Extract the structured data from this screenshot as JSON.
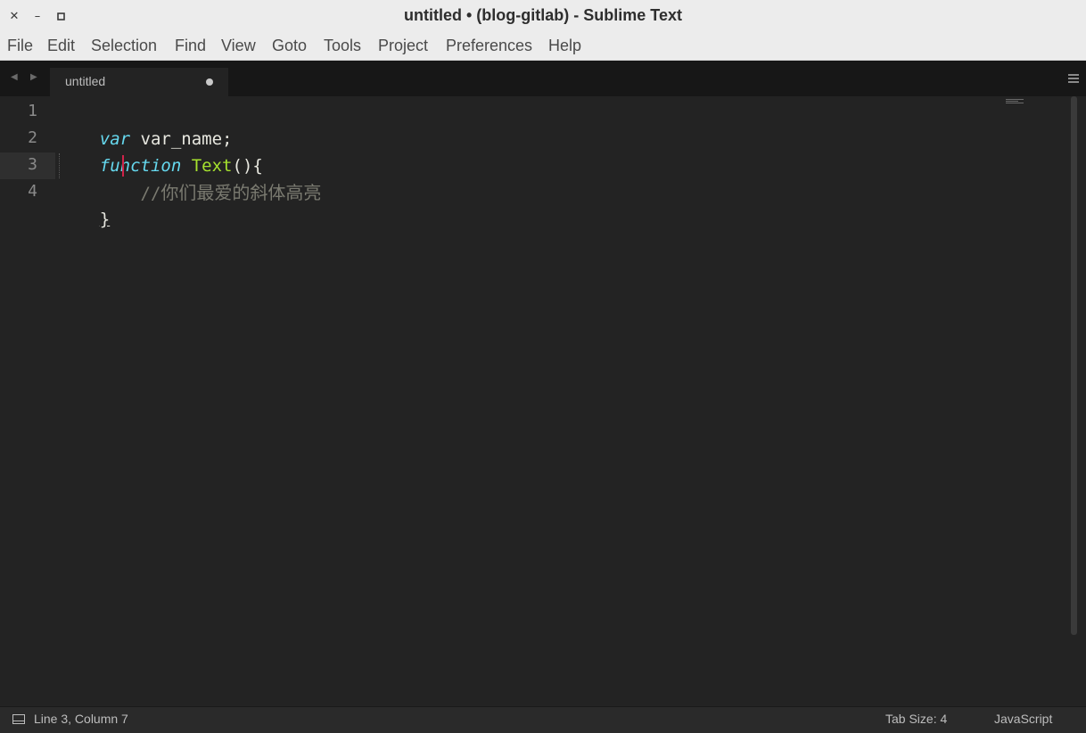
{
  "window": {
    "title": "untitled • (blog-gitlab) - Sublime Text",
    "controls": {
      "close": "✕",
      "minimize": "–",
      "maximize": "▫"
    }
  },
  "menu": {
    "items": [
      "File",
      "Edit",
      "Selection",
      "Find",
      "View",
      "Goto",
      "Tools",
      "Project",
      "Preferences",
      "Help"
    ]
  },
  "tabs": {
    "nav_prev": "◀",
    "nav_next": "▶",
    "items": [
      {
        "label": "untitled",
        "dirty": true
      }
    ]
  },
  "editor": {
    "line_numbers": [
      "1",
      "2",
      "3",
      "4"
    ],
    "current_line": 3,
    "lines": [
      [
        {
          "t": "var",
          "c": "kw"
        },
        {
          "t": " var_name;",
          "c": "ident"
        }
      ],
      [
        {
          "t": "function",
          "c": "kw"
        },
        {
          "t": " ",
          "c": "ident"
        },
        {
          "t": "Text",
          "c": "fn"
        },
        {
          "t": "(){",
          "c": "punc"
        }
      ],
      [
        {
          "t": "    //",
          "c": "cm"
        },
        {
          "t": "你们最爱的斜体高亮",
          "c": "cm"
        }
      ],
      [
        {
          "t": "}",
          "c": "punc"
        }
      ]
    ],
    "colors": {
      "keyword": "#66d9ef",
      "function_name": "#a6e22e",
      "comment": "#7a7a70",
      "text": "#e8e8e0",
      "cursor": "#d0234a",
      "background": "#232323"
    }
  },
  "status": {
    "position": "Line 3, Column 7",
    "tab_size": "Tab Size: 4",
    "syntax": "JavaScript"
  }
}
